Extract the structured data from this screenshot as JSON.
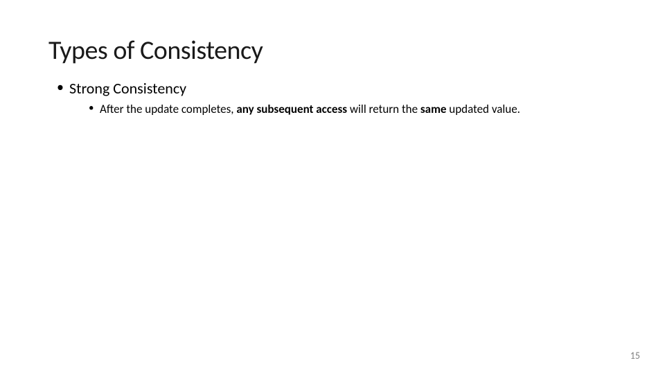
{
  "slide": {
    "title": "Types of Consistency",
    "bullets": {
      "level1_item": "Strong Consistency",
      "level2_prefix": "After the update completes, ",
      "level2_bold1": "any subsequent access",
      "level2_mid": " will return the ",
      "level2_bold2": "same",
      "level2_suffix": " updated value."
    },
    "page_number": "15"
  }
}
